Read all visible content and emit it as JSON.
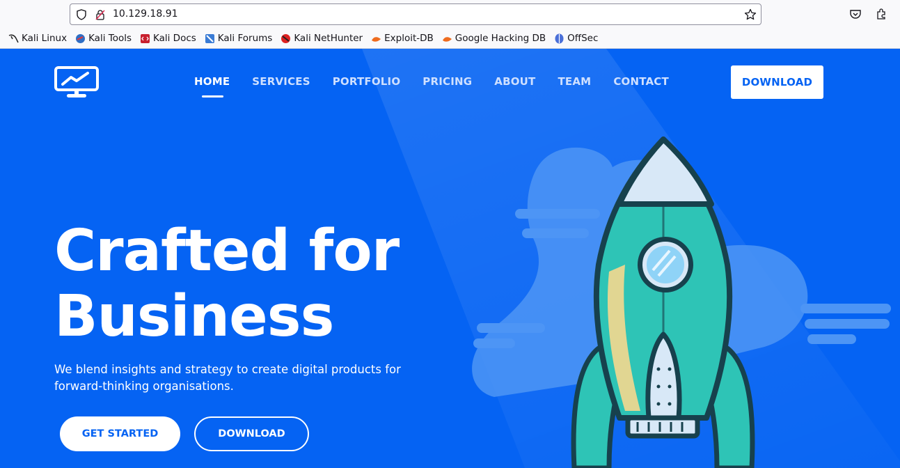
{
  "browser": {
    "url": "10.129.18.91",
    "bookmarks": [
      {
        "label": "Kali Linux",
        "icon": "kali-dragon-icon"
      },
      {
        "label": "Kali Tools",
        "icon": "kali-tools-icon"
      },
      {
        "label": "Kali Docs",
        "icon": "kali-docs-icon"
      },
      {
        "label": "Kali Forums",
        "icon": "kali-forums-icon"
      },
      {
        "label": "Kali NetHunter",
        "icon": "kali-nethunter-icon"
      },
      {
        "label": "Exploit-DB",
        "icon": "exploit-db-icon"
      },
      {
        "label": "Google Hacking DB",
        "icon": "ghdb-icon"
      },
      {
        "label": "OffSec",
        "icon": "offsec-icon"
      }
    ]
  },
  "site": {
    "logo_icon": "monitor-chart-icon",
    "nav": [
      "HOME",
      "SERVICES",
      "PORTFOLIO",
      "PRICING",
      "ABOUT",
      "TEAM",
      "CONTACT"
    ],
    "active_nav": "HOME",
    "download_top": "DOWNLOAD",
    "hero": {
      "title_line1": "Crafted for",
      "title_line2": "Business",
      "subtitle": "We blend insights and strategy to create digital products for forward-thinking organisations.",
      "cta_primary": "GET STARTED",
      "cta_secondary": "DOWNLOAD"
    },
    "colors": {
      "brand_blue": "#0563f3",
      "white": "#ffffff",
      "rocket_teal": "#2ec4b6"
    }
  }
}
